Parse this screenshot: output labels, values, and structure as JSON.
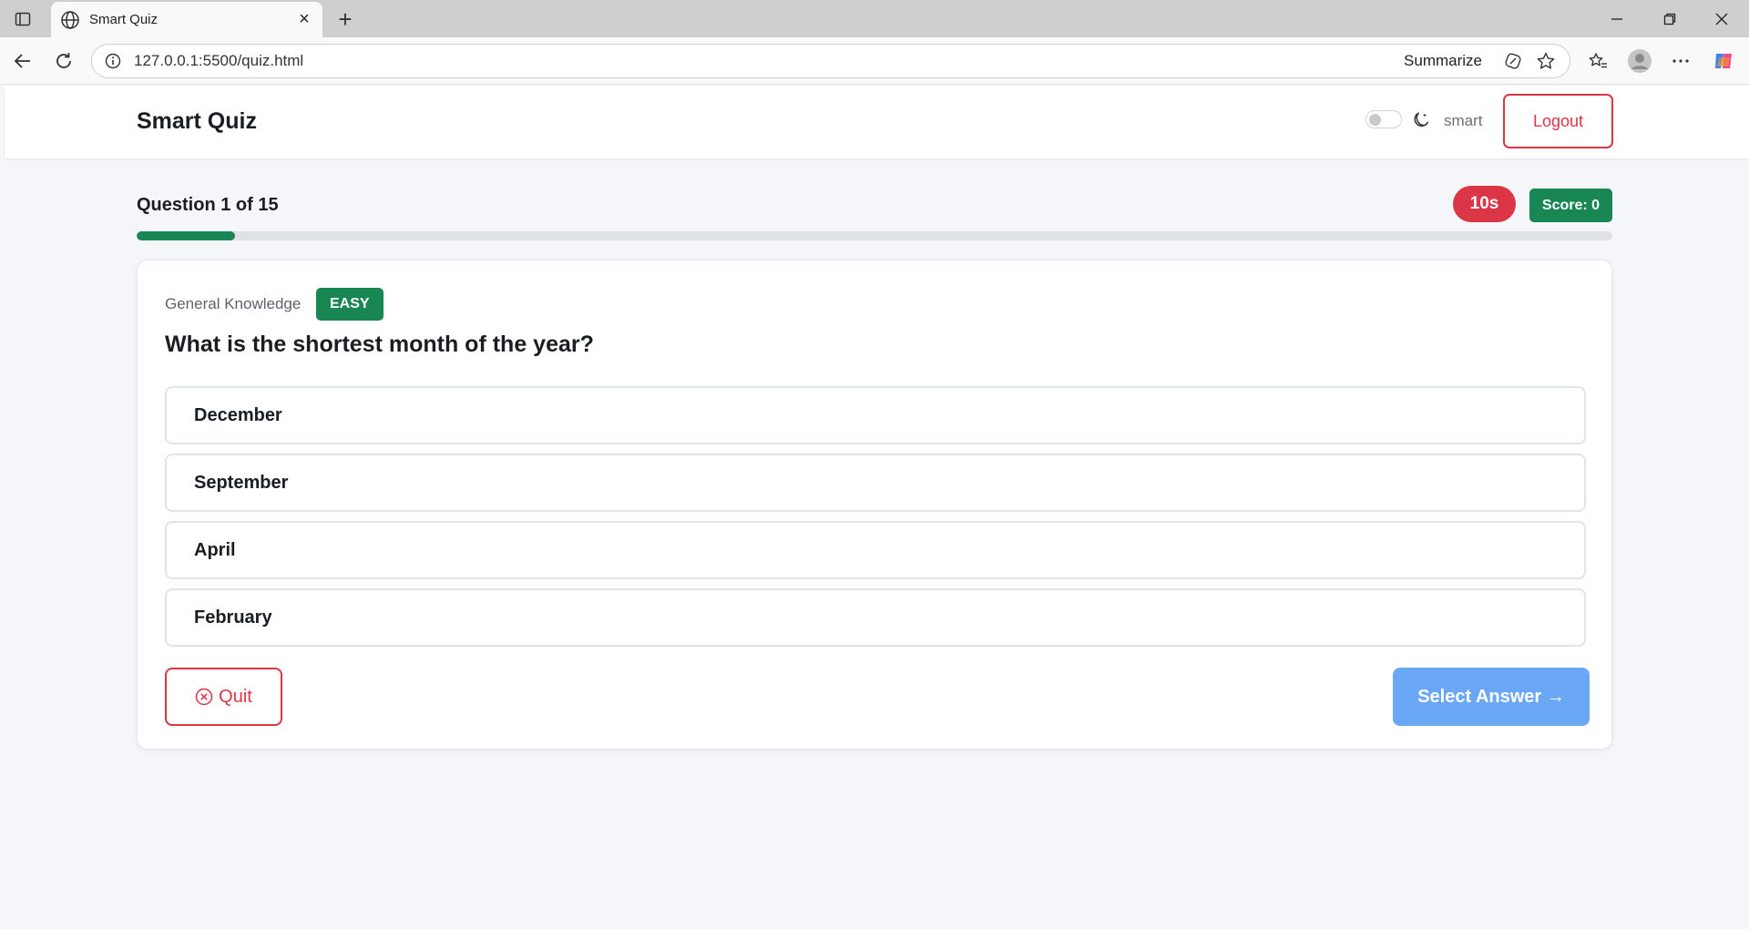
{
  "browser": {
    "tab_title": "Smart Quiz",
    "url": "127.0.0.1:5500/quiz.html",
    "summarize_label": "Summarize"
  },
  "header": {
    "brand": "Smart Quiz",
    "username": "smart",
    "logout_label": "Logout",
    "dark_mode_on": false
  },
  "quiz": {
    "counter": "Question 1 of 15",
    "timer": "10s",
    "score": "Score: 0",
    "progress_fraction": 0.0667
  },
  "question": {
    "category": "General Knowledge",
    "difficulty": "EASY",
    "text": "What is the shortest month of the year?",
    "options": [
      "December",
      "September",
      "April",
      "February"
    ]
  },
  "actions": {
    "quit_label": "Quit",
    "next_label": "Select Answer →"
  },
  "colors": {
    "danger": "#dc3545",
    "success": "#198754",
    "primary_disabled": "#6aa7f5"
  }
}
